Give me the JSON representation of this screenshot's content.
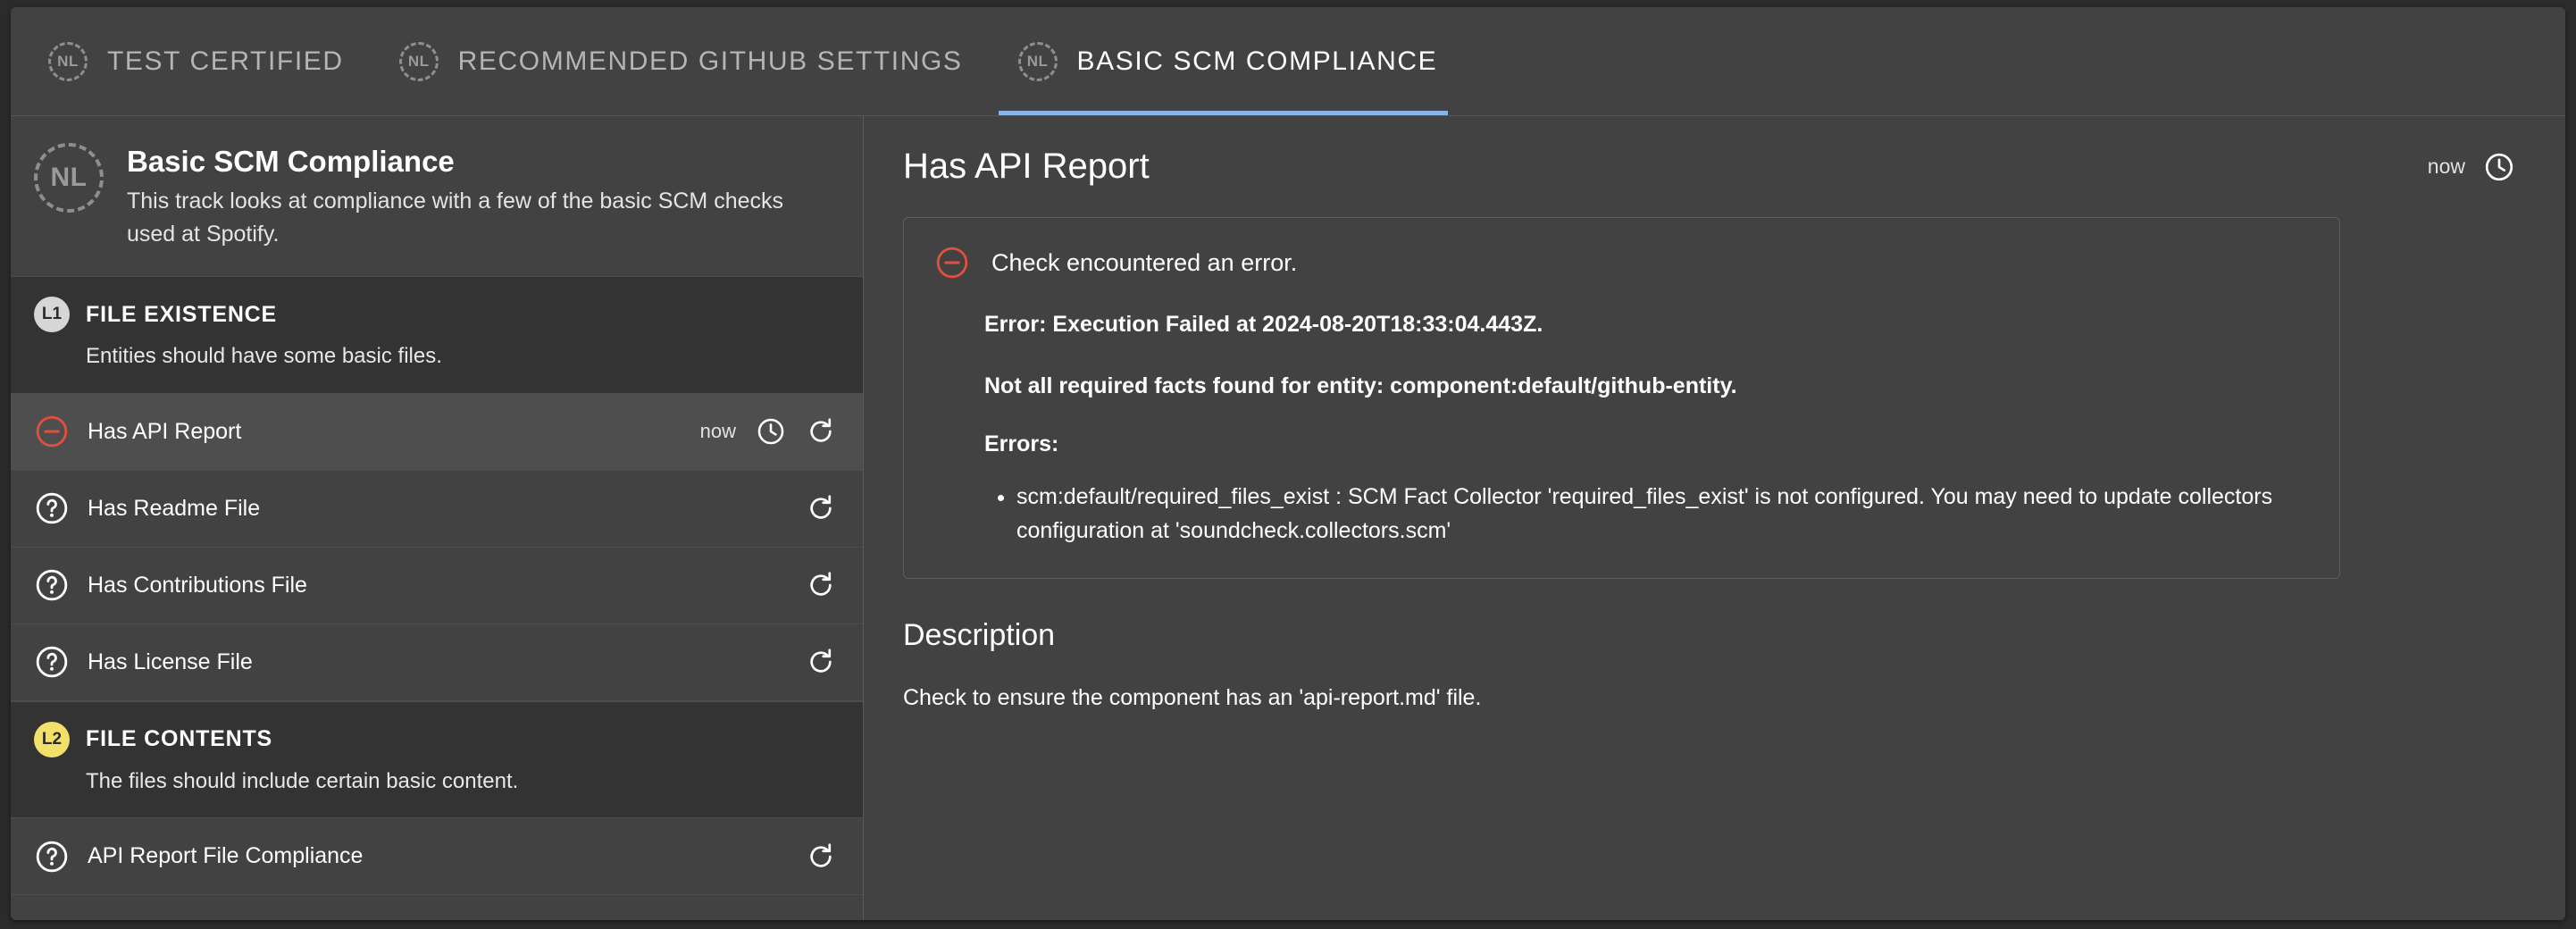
{
  "tabs": [
    {
      "label": "TEST CERTIFIED",
      "avatar": "NL",
      "avatar_icon": "nl-dashed-avatar-icon",
      "active": false
    },
    {
      "label": "RECOMMENDED GITHUB SETTINGS",
      "avatar": "NL",
      "avatar_icon": "nl-dashed-avatar-icon",
      "active": false
    },
    {
      "label": "BASIC SCM COMPLIANCE",
      "avatar": "NL",
      "avatar_icon": "nl-dashed-avatar-icon",
      "active": true
    }
  ],
  "sidebar": {
    "track": {
      "avatar": "NL",
      "title": "Basic SCM Compliance",
      "description": "This track looks at compliance with a few of the basic SCM checks used at Spotify."
    },
    "levels": [
      {
        "badge": "L1",
        "badge_color": "#d6d6d6",
        "title": "FILE EXISTENCE",
        "description": "Entities should have some basic files.",
        "checks": [
          {
            "label": "Has API Report",
            "status_icon": "circle-minus-icon",
            "status_color": "#e0503c",
            "time": "now",
            "has_clock": true,
            "has_refresh": true,
            "selected": true
          },
          {
            "label": "Has Readme File",
            "status_icon": "question-circle-icon",
            "status_color": "#ffffff",
            "time": "",
            "has_clock": false,
            "has_refresh": true,
            "selected": false
          },
          {
            "label": "Has Contributions File",
            "status_icon": "question-circle-icon",
            "status_color": "#ffffff",
            "time": "",
            "has_clock": false,
            "has_refresh": true,
            "selected": false
          },
          {
            "label": "Has License File",
            "status_icon": "question-circle-icon",
            "status_color": "#ffffff",
            "time": "",
            "has_clock": false,
            "has_refresh": true,
            "selected": false
          }
        ]
      },
      {
        "badge": "L2",
        "badge_color": "#f2e06a",
        "title": "FILE CONTENTS",
        "description": "The files should include certain basic content.",
        "checks": [
          {
            "label": "API Report File Compliance",
            "status_icon": "question-circle-icon",
            "status_color": "#ffffff",
            "time": "",
            "has_clock": false,
            "has_refresh": true,
            "selected": false
          }
        ]
      }
    ]
  },
  "main": {
    "title": "Has API Report",
    "time": "now",
    "clock_icon": "clock-icon",
    "error": {
      "status_icon": "circle-minus-icon",
      "headline": "Check encountered an error.",
      "error_line": "Error: Execution Failed at 2024-08-20T18:33:04.443Z.",
      "detail_line": "Not all required facts found for entity: component:default/github-entity.",
      "errors_label": "Errors:",
      "items": [
        "scm:default/required_files_exist : SCM Fact Collector 'required_files_exist' is not configured. You may need to update collectors configuration at 'soundcheck.collectors.scm'"
      ]
    },
    "description": {
      "heading": "Description",
      "text": "Check to ensure the component has an 'api-report.md' file."
    }
  },
  "colors": {
    "accent": "#8ab4e8",
    "error": "#e0503c",
    "level1_badge": "#d6d6d6",
    "level2_badge": "#f2e06a",
    "background": "#424242",
    "section_background": "#333333",
    "selected_row": "#4e4e4e"
  }
}
